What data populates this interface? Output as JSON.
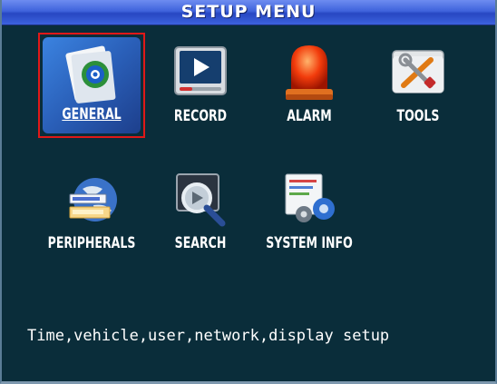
{
  "title": "SETUP MENU",
  "menu": [
    {
      "label": "GENERAL",
      "icon": "general-settings-icon",
      "selected": true
    },
    {
      "label": "RECORD",
      "icon": "record-play-icon"
    },
    {
      "label": "ALARM",
      "icon": "alarm-beacon-icon"
    },
    {
      "label": "TOOLS",
      "icon": "tools-icon"
    },
    {
      "label": "PERIPHERALS",
      "icon": "peripherals-globe-icon"
    },
    {
      "label": "SEARCH",
      "icon": "search-magnifier-icon"
    },
    {
      "label": "SYSTEM INFO",
      "icon": "system-info-icon"
    }
  ],
  "description": "Time,vehicle,user,network,display setup",
  "colors": {
    "background": "#0a2d3a",
    "titlebar": "#3f63dc",
    "selection": "#e01818"
  }
}
